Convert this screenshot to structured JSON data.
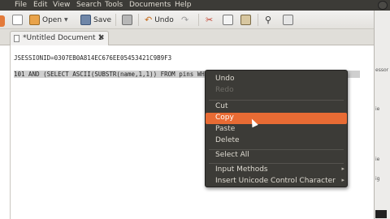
{
  "menubar": {
    "items": [
      "File",
      "Edit",
      "View",
      "Search",
      "Tools",
      "Documents",
      "Help"
    ]
  },
  "toolbar": {
    "open_label": "Open",
    "save_label": "Save",
    "undo_label": "Undo"
  },
  "tab": {
    "title": "*Untitled Document 1",
    "close": "✖"
  },
  "editor": {
    "line1": "JSESSIONID=0307EB0A814EC676EE05453421C9B9F3",
    "line2": "101 AND (SELECT ASCII(SUBSTR(name,1,1)) FROM pins WHERE cc_number=4321432143214321)>5 --"
  },
  "right_panel": {
    "fragments": [
      "essor",
      "ie",
      "ie",
      "ig"
    ]
  },
  "context_menu": {
    "undo": "Undo",
    "redo": "Redo",
    "cut": "Cut",
    "copy": "Copy",
    "paste": "Paste",
    "delete": "Delete",
    "select_all": "Select All",
    "input_methods": "Input Methods",
    "insert_unicode": "Insert Unicode Control Character",
    "submenu_arrow": "▸"
  },
  "colors": {
    "menubar": "#3c3b37",
    "highlight": "#e86b34",
    "selection": "#cfcfcf"
  }
}
